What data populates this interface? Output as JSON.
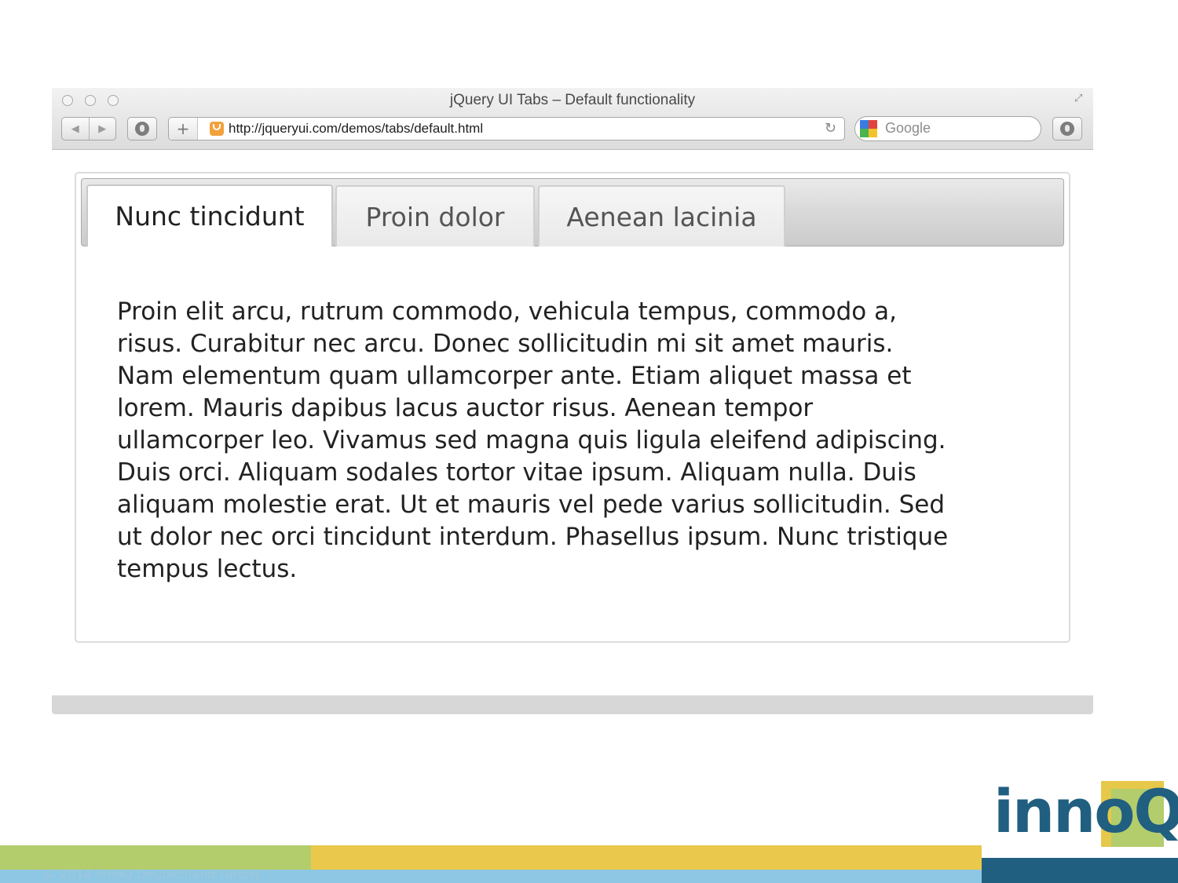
{
  "window": {
    "title": "jQuery UI Tabs – Default functionality",
    "url": "http://jqueryui.com/demos/tabs/default.html",
    "search_placeholder": "Google"
  },
  "tabs": [
    {
      "label": "Nunc tincidunt",
      "active": true
    },
    {
      "label": "Proin dolor",
      "active": false
    },
    {
      "label": "Aenean lacinia",
      "active": false
    }
  ],
  "panel": {
    "lines": [
      "Proin elit arcu, rutrum commodo, vehicula tempus, commodo a,",
      "risus. Curabitur nec arcu. Donec sollicitudin mi sit amet mauris.",
      "Nam elementum quam ullamcorper ante. Etiam aliquet massa et",
      "lorem. Mauris dapibus lacus auctor risus. Aenean tempor",
      "ullamcorper leo. Vivamus sed magna quis ligula eleifend adipiscing.",
      "Duis orci. Aliquam sodales tortor vitae ipsum. Aliquam nulla. Duis",
      "aliquam molestie erat. Ut et mauris vel pede varius sollicitudin. Sed",
      "ut dolor nec orci tincidunt interdum. Phasellus ipsum. Nunc tristique",
      "tempus lectus."
    ]
  },
  "footer": {
    "logo_text": "innoQ",
    "copyright": "© 2014 innoQ Deutschland GmbH"
  },
  "colors": {
    "brand_blue": "#215f80",
    "stripe_green": "#b3cd6c",
    "stripe_yellow": "#e9c84c",
    "stripe_light_blue": "#8ec7e4"
  }
}
